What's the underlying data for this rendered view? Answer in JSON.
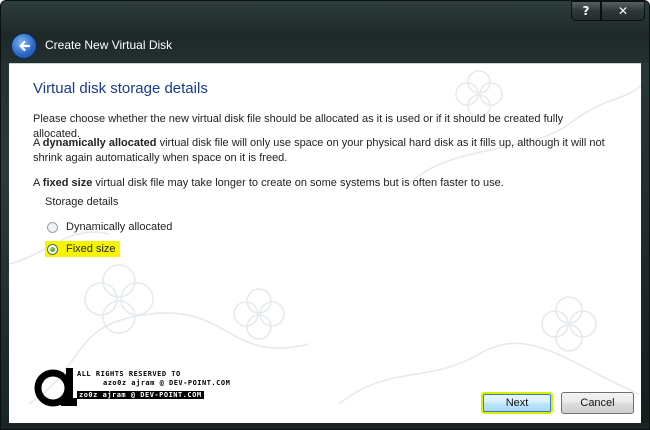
{
  "window": {
    "title": "Create New Virtual Disk",
    "help_label": "?",
    "close_label": "✕"
  },
  "page": {
    "heading": "Virtual disk storage details",
    "intro": "Please choose whether the new virtual disk file should be allocated as it is used or if it should be created fully allocated.",
    "dynamic_prefix": "A ",
    "dynamic_bold": "dynamically allocated",
    "dynamic_rest": " virtual disk file will only use space on your physical hard disk as it fills up, although it will not shrink again automatically when space on it is freed.",
    "fixed_prefix": "A ",
    "fixed_bold": "fixed size",
    "fixed_rest": " virtual disk file may take longer to create on some systems but is often faster to use."
  },
  "storage": {
    "group_label": "Storage details",
    "options": [
      {
        "label": "Dynamically allocated",
        "checked": false
      },
      {
        "label": "Fixed size",
        "checked": true
      }
    ]
  },
  "watermark": {
    "line1": "ALL RIGHTS RESERVED TO",
    "line2": "azo0z ajram @ DEV-POINT.COM",
    "line3": "zo0z ajram @ DEV-POINT.COM"
  },
  "buttons": {
    "next_label": "Next",
    "cancel_label": "Cancel"
  },
  "colors": {
    "heading": "#1a3a8f",
    "highlight": "#f5f500",
    "next_border": "#d8f000"
  }
}
